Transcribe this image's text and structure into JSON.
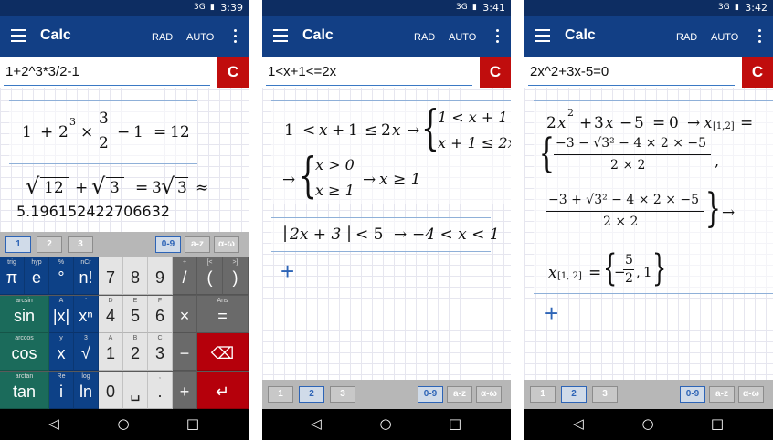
{
  "screens": [
    {
      "time": "3:39",
      "signal": "3G",
      "title": "Calc",
      "rad": "RAD",
      "auto": "AUTO",
      "input": "1+2^3*3/2-1",
      "clear": "C",
      "expr": {
        "a": "1",
        "p": "+",
        "b": "2",
        "e": "3",
        "x": "×",
        "n": "3",
        "d": "2",
        "m": "−",
        "c": "1",
        "eq": "=",
        "r": "12"
      },
      "root_line": {
        "r12": "12",
        "plus": "+",
        "r3": "3",
        "eq": "=",
        "res": "3",
        "res_rad": "3",
        "approx": "≈"
      },
      "decimal": "5.196152422706632",
      "tabs": [
        "1",
        "2",
        "3"
      ],
      "tabs_right": [
        "0-9",
        "a-z",
        "α-ω"
      ],
      "keys": [
        {
          "l": "π",
          "s": "trig"
        },
        {
          "l": "e",
          "s": "hyp"
        },
        {
          "l": "°",
          "s": "%"
        },
        {
          "l": "n!",
          "s": "nCr"
        },
        {
          "l": "7",
          "s": ""
        },
        {
          "l": "8",
          "s": ""
        },
        {
          "l": "9",
          "s": ""
        },
        {
          "l": "/",
          "s": "÷"
        },
        {
          "l": "(",
          "s": "[<"
        },
        {
          "l": ")",
          "s": ">]"
        },
        {
          "l": "sin",
          "s": "arcsin"
        },
        {
          "l": "|x|",
          "s": "A"
        },
        {
          "l": "xⁿ",
          "s": "'"
        },
        {
          "l": "4",
          "s": "D"
        },
        {
          "l": "5",
          "s": "E"
        },
        {
          "l": "6",
          "s": "F"
        },
        {
          "l": "×",
          "s": ""
        },
        {
          "l": "=",
          "s": "Ans"
        },
        {
          "l": "cos",
          "s": "arccos"
        },
        {
          "l": "x",
          "s": "y"
        },
        {
          "l": "√",
          "s": "3"
        },
        {
          "l": "1",
          "s": "A"
        },
        {
          "l": "2",
          "s": "B"
        },
        {
          "l": "3",
          "s": "C"
        },
        {
          "l": "−",
          "s": ""
        },
        {
          "l": "⌫",
          "s": ""
        },
        {
          "l": "tan",
          "s": "arctan"
        },
        {
          "l": "i",
          "s": "Re"
        },
        {
          "l": "ln",
          "s": "log"
        },
        {
          "l": "0",
          "s": ""
        },
        {
          "l": "␣",
          "s": ""
        },
        {
          "l": ".",
          "s": ","
        },
        {
          "l": "+",
          "s": ""
        },
        {
          "l": "↵",
          "s": ""
        }
      ]
    },
    {
      "time": "3:41",
      "signal": "3G",
      "title": "Calc",
      "rad": "RAD",
      "auto": "AUTO",
      "input": "1<x+1<=2x",
      "clear": "C",
      "ineq": {
        "l1": "1",
        "lt": "<",
        "x": "x",
        "p": "+",
        "one": "1",
        "le": "≤",
        "two": "2",
        "x2": "x",
        "arrow": "→"
      },
      "sys1": {
        "a": "1 < x + 1",
        "b": "x + 1 ≤ 2x"
      },
      "sys2": {
        "arrow": "→",
        "a": "x > 0",
        "b": "x ≥ 1",
        "arrow2": "→",
        "res": "x ≥ 1"
      },
      "absline": {
        "abs": "2x + 3",
        "lt": "< 5",
        "arrow": "→",
        "res": "−4 < x < 1"
      },
      "add": "+",
      "tabs": [
        "1",
        "2",
        "3"
      ],
      "tabs_right": [
        "0-9",
        "a-z",
        "α-ω"
      ]
    },
    {
      "time": "3:42",
      "signal": "3G",
      "title": "Calc",
      "rad": "RAD",
      "auto": "AUTO",
      "input": "2x^2+3x-5=0",
      "clear": "C",
      "quad": {
        "a": "2",
        "x": "x",
        "e": "2",
        "p": "+",
        "b": "3",
        "x2": "x",
        "m": "−",
        "c": "5",
        "eq": "=",
        "z": "0",
        "arrow": "→",
        "xs": "x",
        "sub": "[1,2]",
        "eq2": "="
      },
      "frac1": {
        "num": "−3 − √3² − 4 × 2 × −5",
        "den": "2 × 2"
      },
      "frac2": {
        "num": "−3 + √3² − 4 × 2 × −5",
        "den": "2 × 2"
      },
      "result": {
        "x": "x",
        "sub": "[1, 2]",
        "eq": "=",
        "n": "5",
        "d": "2",
        "one": "1"
      },
      "add": "+",
      "tabs": [
        "1",
        "2",
        "3"
      ],
      "tabs_right": [
        "0-9",
        "a-z",
        "α-ω"
      ]
    }
  ],
  "nav": {
    "back": "◁",
    "home": "○",
    "recent": "□"
  }
}
